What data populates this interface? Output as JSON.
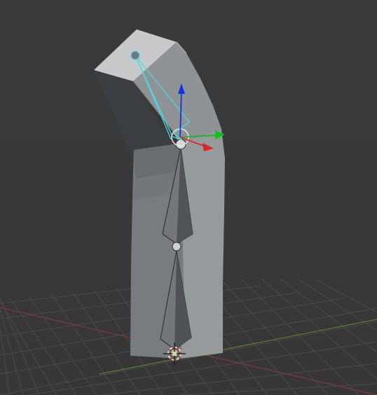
{
  "viewport": {
    "background_color": "#393939",
    "grid_color": "#4d4d4d",
    "x_axis_color": "#8a3b3b",
    "y_axis_color": "#5f8a3b",
    "mesh_top_color": "#c9c9c9",
    "mesh_front_color": "#8f9396",
    "mesh_side_color": "#3c4145",
    "bone_color": "#6f7276",
    "bone_dark_color": "#2b2d2f",
    "bone_light_color": "#a9acaf",
    "selected_bone_outline_color": "#4fd9e0",
    "gizmo": {
      "x_axis_color": "#e31f2a",
      "y_axis_color": "#16c11a",
      "z_axis_color": "#1428d9"
    },
    "cursor_color": "#e9d7d8",
    "cursor_red": "#c9463d"
  }
}
